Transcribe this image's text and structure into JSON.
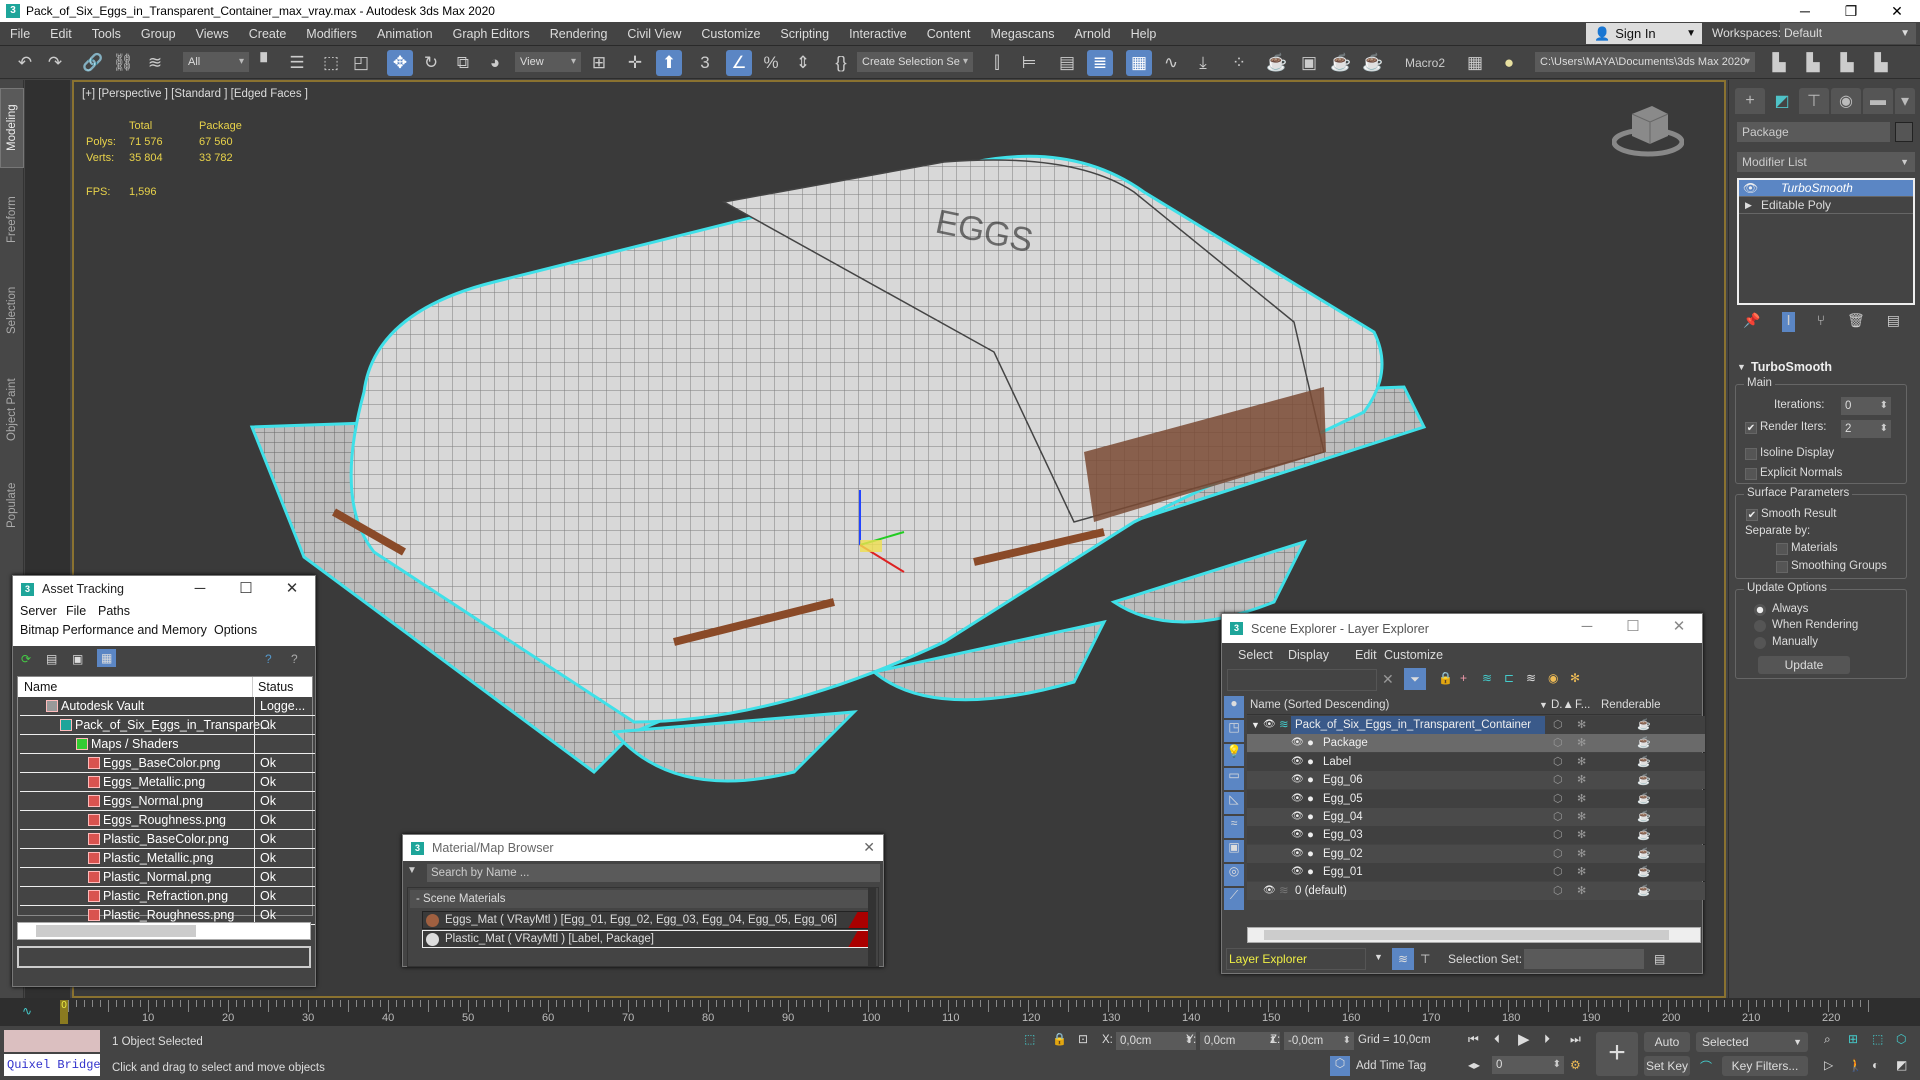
{
  "window": {
    "title": "Pack_of_Six_Eggs_in_Transparent_Container_max_vray.max - Autodesk 3ds Max 2020",
    "app_icon": "3ds-max-icon",
    "controls": [
      "minimize",
      "restore",
      "close"
    ]
  },
  "menubar": {
    "items": [
      "File",
      "Edit",
      "Tools",
      "Group",
      "Views",
      "Create",
      "Modifiers",
      "Animation",
      "Graph Editors",
      "Rendering",
      "Civil View",
      "Customize",
      "Scripting",
      "Interactive",
      "Content",
      "Megascans",
      "Arnold",
      "Help"
    ],
    "sign_in": "Sign In",
    "workspaces_label": "Workspaces:",
    "workspace": "Default"
  },
  "toolbar": {
    "selection_filter": "All",
    "ref_coord": "View",
    "named_selection": "Create Selection Se",
    "macro": "Macro2",
    "project_path": "C:\\Users\\MAYA\\Documents\\3ds Max 2020"
  },
  "ribbon_tabs": [
    "Modeling",
    "Freeform",
    "Selection",
    "Object Paint",
    "Populate"
  ],
  "viewport": {
    "label": "[+] [Perspective ] [Standard ] [Edged Faces ]",
    "stats": {
      "col_total": "Total",
      "col_selected": "Package",
      "polys_label": "Polys:",
      "polys_total": "71 576",
      "polys_selected": "67 560",
      "verts_label": "Verts:",
      "verts_total": "35 804",
      "verts_selected": "33 782",
      "fps_label": "FPS:",
      "fps": "1,596"
    }
  },
  "command_panel": {
    "object_name": "Package",
    "modifier_list": "Modifier List",
    "stack": [
      "TurboSmooth",
      "Editable Poly"
    ],
    "rollout_title": "TurboSmooth",
    "main_group": "Main",
    "iterations_label": "Iterations:",
    "iterations": "0",
    "render_iters_label": "Render Iters:",
    "render_iters": "2",
    "render_iters_checked": true,
    "isoline_display": "Isoline Display",
    "explicit_normals": "Explicit Normals",
    "surface_group": "Surface Parameters",
    "smooth_result": "Smooth Result",
    "separate_by": "Separate by:",
    "materials": "Materials",
    "smoothing_groups": "Smoothing Groups",
    "update_group": "Update Options",
    "update_always": "Always",
    "update_rendering": "When Rendering",
    "update_manually": "Manually",
    "update_button": "Update"
  },
  "asset_tracking": {
    "title": "Asset Tracking",
    "menu1": [
      "Server",
      "File",
      "Paths"
    ],
    "menu2": [
      "Bitmap Performance and Memory",
      "Options"
    ],
    "col_name": "Name",
    "col_status": "Status",
    "rows": [
      {
        "name": "Autodesk Vault",
        "status": "Logge..."
      },
      {
        "name": "Pack_of_Six_Eggs_in_Transpare...",
        "status": "Ok"
      },
      {
        "name": "Maps / Shaders",
        "status": ""
      },
      {
        "name": "Eggs_BaseColor.png",
        "status": "Ok"
      },
      {
        "name": "Eggs_Metallic.png",
        "status": "Ok"
      },
      {
        "name": "Eggs_Normal.png",
        "status": "Ok"
      },
      {
        "name": "Eggs_Roughness.png",
        "status": "Ok"
      },
      {
        "name": "Plastic_BaseColor.png",
        "status": "Ok"
      },
      {
        "name": "Plastic_Metallic.png",
        "status": "Ok"
      },
      {
        "name": "Plastic_Normal.png",
        "status": "Ok"
      },
      {
        "name": "Plastic_Refraction.png",
        "status": "Ok"
      },
      {
        "name": "Plastic_Roughness.png",
        "status": "Ok"
      }
    ]
  },
  "material_browser": {
    "title": "Material/Map Browser",
    "search_placeholder": "Search by Name ...",
    "group": "- Scene Materials",
    "materials": [
      "Eggs_Mat  ( VRayMtl )  [Egg_01, Egg_02, Egg_03, Egg_04, Egg_05, Egg_06]",
      "Plastic_Mat  ( VRayMtl )  [Label, Package]"
    ]
  },
  "scene_explorer": {
    "title": "Scene Explorer - Layer Explorer",
    "menu": [
      "Select",
      "Display",
      "Edit",
      "Customize"
    ],
    "col_name": "Name (Sorted Descending)",
    "col_d": "D.▲",
    "col_f": "F...",
    "col_renderable": "Renderable",
    "rows": [
      {
        "name": "Pack_of_Six_Eggs_in_Transparent_Container",
        "level": 0,
        "type": "layer"
      },
      {
        "name": "Package",
        "level": 1,
        "type": "object"
      },
      {
        "name": "Label",
        "level": 1,
        "type": "object"
      },
      {
        "name": "Egg_06",
        "level": 1,
        "type": "object"
      },
      {
        "name": "Egg_05",
        "level": 1,
        "type": "object"
      },
      {
        "name": "Egg_04",
        "level": 1,
        "type": "object"
      },
      {
        "name": "Egg_03",
        "level": 1,
        "type": "object"
      },
      {
        "name": "Egg_02",
        "level": 1,
        "type": "object"
      },
      {
        "name": "Egg_01",
        "level": 1,
        "type": "object"
      },
      {
        "name": "0 (default)",
        "level": 0,
        "type": "layer"
      }
    ],
    "explorer_type": "Layer Explorer",
    "selection_set_label": "Selection Set:"
  },
  "timeline": {
    "current_frame": "0",
    "labels": [
      "10",
      "20",
      "30",
      "40",
      "50",
      "60",
      "70",
      "80",
      "90",
      "100",
      "110",
      "120",
      "130",
      "140",
      "150",
      "160",
      "170",
      "180",
      "190",
      "200",
      "210",
      "220"
    ]
  },
  "status": {
    "maxscript": "Quixel Bridge",
    "selected": "1 Object Selected",
    "prompt": "Click and drag to select and move objects",
    "x_label": "X:",
    "x": "0,0cm",
    "y_label": "Y:",
    "y": "0,0cm",
    "z_label": "Z:",
    "z": "-0,0cm",
    "grid": "Grid = 10,0cm",
    "add_time_tag": "Add Time Tag",
    "frame": "0",
    "auto_key": "Auto Key",
    "set_key": "Set Key",
    "key_mode": "Selected",
    "key_filters": "Key Filters..."
  }
}
